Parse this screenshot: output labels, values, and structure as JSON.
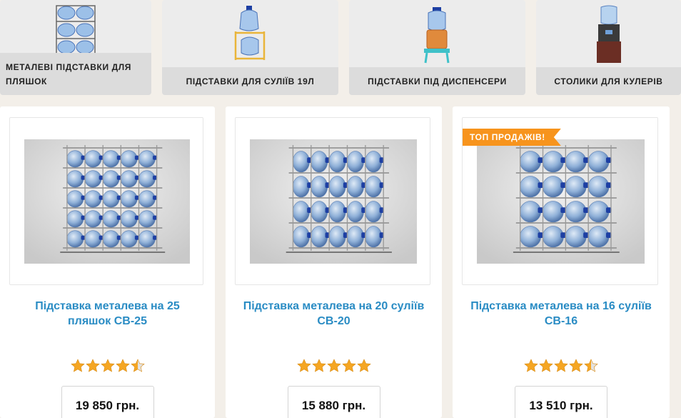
{
  "categories": [
    {
      "label": "МЕТАЛЕВІ ПІДСТАВКИ ДЛЯ ПЛЯШОК",
      "icon": "bottle-rack-image"
    },
    {
      "label": "ПІДСТАВКИ ДЛЯ СУЛІЇВ 19Л",
      "icon": "bottle-stand-image"
    },
    {
      "label": "ПІДСТАВКИ ПІД ДИСПЕНСЕРИ",
      "icon": "dispenser-stand-image"
    },
    {
      "label": "СТОЛИКИ ДЛЯ КУЛЕРІВ",
      "icon": "cooler-table-image"
    }
  ],
  "products": [
    {
      "title": "Підставка металева на 25 пляшок СВ-25",
      "price": "19 850 грн.",
      "rating": 4.5,
      "badge": "",
      "bottle_rows": 5,
      "bottle_cols": 5
    },
    {
      "title": "Підставка металева на 20 суліїв СВ-20",
      "price": "15 880 грн.",
      "rating": 5,
      "badge": "",
      "bottle_rows": 4,
      "bottle_cols": 5
    },
    {
      "title": "Підставка металева на 16 суліїв СВ-16",
      "price": "13 510 грн.",
      "rating": 4.5,
      "badge": "ТОП ПРОДАЖІВ!",
      "bottle_rows": 4,
      "bottle_cols": 4
    }
  ],
  "colors": {
    "link": "#2a8cc4",
    "star": "#f5a623",
    "badge": "#f7941d",
    "bottle": "#7fa6d6",
    "cap": "#1d3fa3"
  }
}
